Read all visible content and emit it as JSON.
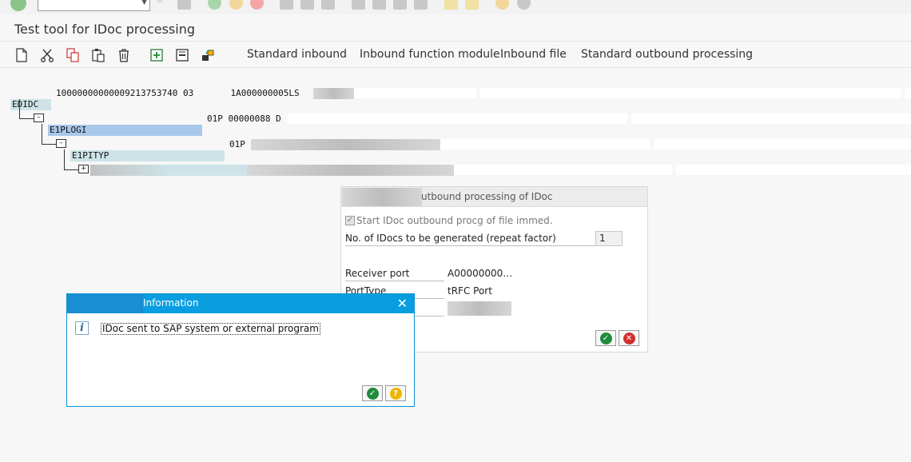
{
  "window": {
    "title": "Test tool for IDoc processing"
  },
  "system_toolbar": {
    "command_field": {
      "value": "",
      "placeholder": ""
    }
  },
  "app_toolbar": {
    "buttons": [
      {
        "label": "Standard inbound"
      },
      {
        "label": "Inbound function module"
      },
      {
        "label": "Inbound file"
      },
      {
        "label": "Standard outbound processing"
      }
    ]
  },
  "tree": {
    "control_record": {
      "segment": "EDIDC",
      "value": "10000000000009213753740 03       1A000000005LS"
    },
    "segments": [
      {
        "name": "E1PLOGI",
        "value": "01P 00000088 D"
      },
      {
        "name": "E1PITYP",
        "value": "01P"
      }
    ]
  },
  "outbound_dialog": {
    "title": "utbound processing of IDoc",
    "checkbox_label": "Start IDoc outbound procg of file immed.",
    "repeat_label": "No. of IDocs to be generated (repeat factor)",
    "repeat_value": "1",
    "receiver_port_label": "Receiver port",
    "receiver_port_value": "A00000000…",
    "port_type_label": "PortType",
    "port_type_value": "tRFC Port"
  },
  "info_popup": {
    "title": "Information",
    "message": "IDoc sent to SAP system or external program",
    "close_symbol": "✕",
    "icon_glyph": "i"
  },
  "colors": {
    "popup_header": "#0a9ee0",
    "segment_highlight": "#a8c8ea",
    "segment_light": "#cde3e7",
    "ok_green": "#1e8b3c",
    "cancel_red": "#d32f2f",
    "help_yellow": "#f2b400"
  }
}
